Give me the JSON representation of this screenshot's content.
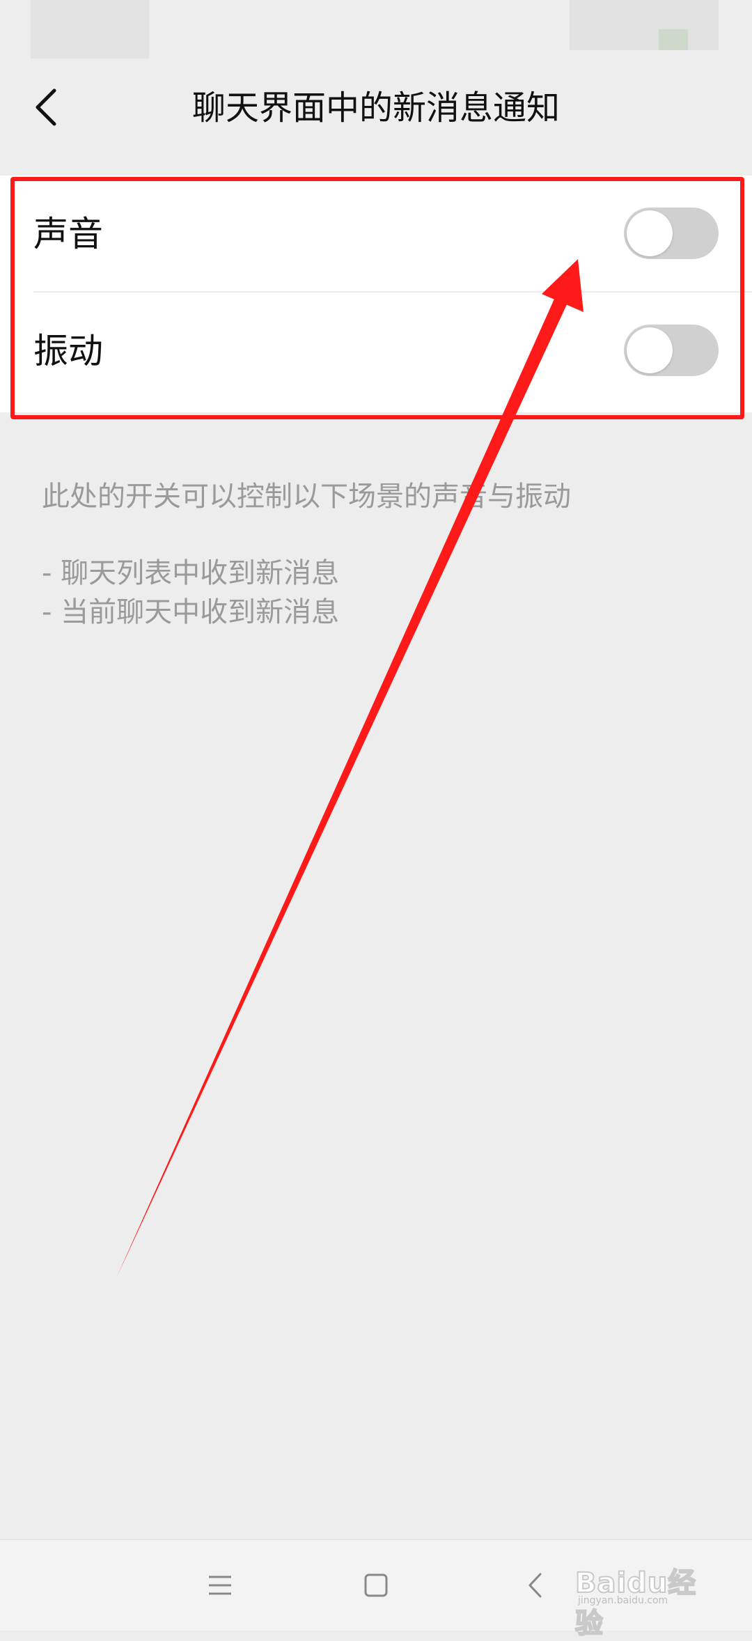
{
  "header": {
    "title": "聊天界面中的新消息通知"
  },
  "settings": [
    {
      "label": "声音",
      "enabled": false
    },
    {
      "label": "振动",
      "enabled": false
    }
  ],
  "description": {
    "line1": "此处的开关可以控制以下场景的声音与振动",
    "line2": "- 聊天列表中收到新消息",
    "line3": "- 当前聊天中收到新消息"
  },
  "colors": {
    "background": "#ededed",
    "card": "#ffffff",
    "toggle_off": "#d0d0d0",
    "annotation_red": "#ff1a1a",
    "muted_text": "#9a9a9a"
  },
  "icons": {
    "back": "chevron-left-icon",
    "nav_menu": "menu-icon",
    "nav_home": "square-icon",
    "nav_back": "chevron-left-icon"
  },
  "watermark": {
    "text": "Baidu经验",
    "sub": "jingyan.baidu.com"
  }
}
